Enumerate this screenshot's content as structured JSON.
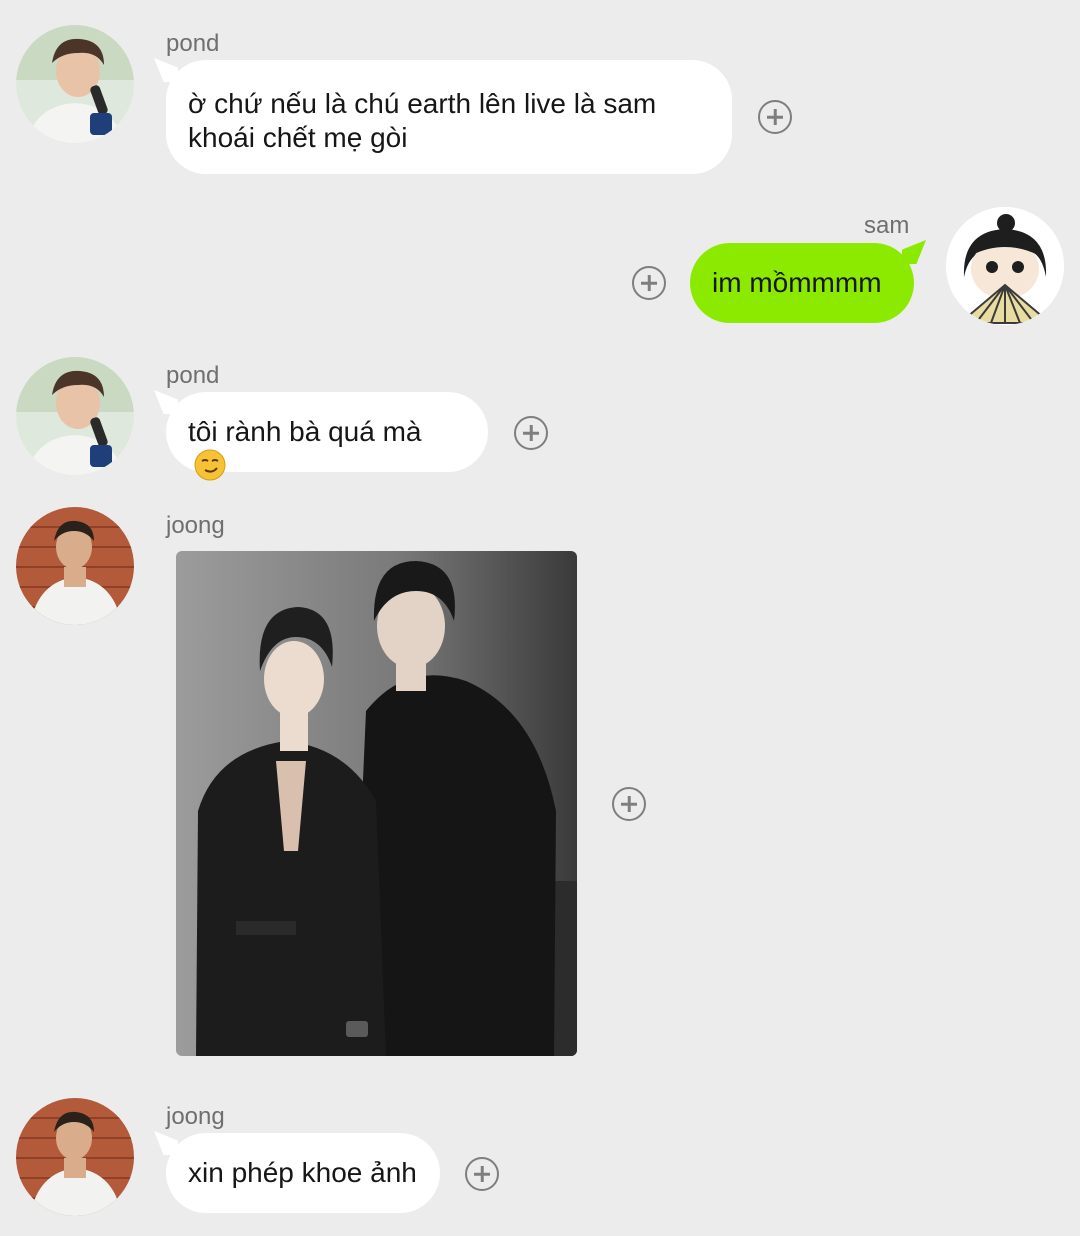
{
  "messages": [
    {
      "sender": "pond",
      "text_line1": "ờ chứ nếu là chú earth lên live là sam",
      "text_line2": "khoái chết mẹ gòi",
      "direction": "incoming"
    },
    {
      "sender": "sam",
      "text": "im mồmmmm",
      "direction": "outgoing"
    },
    {
      "sender": "pond",
      "text": "tôi rành bà quá mà",
      "emoji": "😏",
      "direction": "incoming"
    },
    {
      "sender": "joong",
      "type": "photo",
      "direction": "incoming"
    },
    {
      "sender": "joong",
      "text": "xin phép khoe ảnh",
      "direction": "incoming"
    }
  ],
  "icons": {
    "react": "plus-circle-icon",
    "avatar_pond": "user-avatar",
    "avatar_sam": "cartoon-avatar",
    "avatar_joong": "user-avatar"
  },
  "colors": {
    "background": "#ececec",
    "incoming_bubble": "#ffffff",
    "outgoing_bubble": "#8bea00",
    "sender_text": "#6f6f6f",
    "icon": "#7e7e7e"
  }
}
